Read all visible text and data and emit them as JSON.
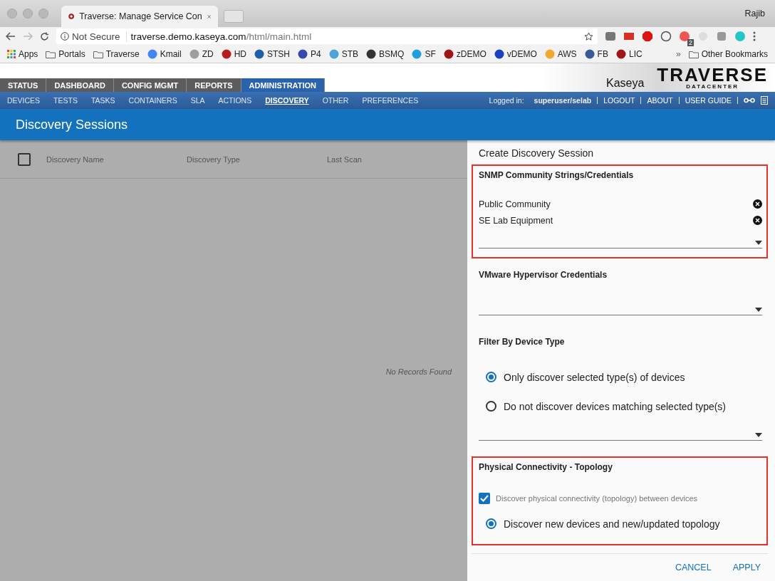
{
  "browser": {
    "tab_title": "Traverse: Manage Service Con",
    "profile": "Rajib",
    "security": "Not Secure",
    "url_host": "traverse.demo.kaseya.com",
    "url_path": "/html/main.html",
    "extension_badge": "2",
    "bookmarks": [
      {
        "kind": "apps",
        "label": "Apps"
      },
      {
        "kind": "folder",
        "label": "Portals"
      },
      {
        "kind": "folder",
        "label": "Traverse"
      },
      {
        "kind": "site",
        "label": "Kmail",
        "color": "#4285f4"
      },
      {
        "kind": "site",
        "label": "ZD",
        "color": "#9e9e9e"
      },
      {
        "kind": "site",
        "label": "HD",
        "color": "#b71c1c"
      },
      {
        "kind": "site",
        "label": "STSH",
        "color": "#1f5fa8"
      },
      {
        "kind": "site",
        "label": "P4",
        "color": "#3949ab"
      },
      {
        "kind": "site",
        "label": "STB",
        "color": "#4fa3d9"
      },
      {
        "kind": "site",
        "label": "BSMQ",
        "color": "#333333"
      },
      {
        "kind": "site",
        "label": "SF",
        "color": "#1ea0e0"
      },
      {
        "kind": "site",
        "label": "zDEMO",
        "color": "#a01515"
      },
      {
        "kind": "site",
        "label": "vDEMO",
        "color": "#1a3fc4"
      },
      {
        "kind": "site",
        "label": "AWS",
        "color": "#f0a830"
      },
      {
        "kind": "site",
        "label": "FB",
        "color": "#3b5998"
      },
      {
        "kind": "site",
        "label": "LIC",
        "color": "#a01515"
      }
    ],
    "overflow": "»",
    "other_bookmarks": "Other Bookmarks"
  },
  "header": {
    "logo_brand": "Kaseya",
    "logo_product": "TRAVERSE",
    "logo_sub": "DATACENTER",
    "main_tabs": [
      {
        "label": "STATUS",
        "selected": false
      },
      {
        "label": "DASHBOARD",
        "selected": false
      },
      {
        "label": "CONFIG MGMT",
        "selected": false
      },
      {
        "label": "REPORTS",
        "selected": false
      },
      {
        "label": "ADMINISTRATION",
        "selected": true
      }
    ],
    "sub_nav": [
      {
        "label": "DEVICES",
        "selected": false
      },
      {
        "label": "TESTS",
        "selected": false
      },
      {
        "label": "TASKS",
        "selected": false
      },
      {
        "label": "CONTAINERS",
        "selected": false
      },
      {
        "label": "SLA",
        "selected": false
      },
      {
        "label": "ACTIONS",
        "selected": false
      },
      {
        "label": "DISCOVERY",
        "selected": true
      },
      {
        "label": "OTHER",
        "selected": false
      },
      {
        "label": "PREFERENCES",
        "selected": false
      }
    ],
    "logged_in_label": "Logged in:",
    "user": "superuser/selab",
    "links": [
      "LOGOUT",
      "ABOUT",
      "USER GUIDE"
    ]
  },
  "page_title": "Discovery Sessions",
  "table": {
    "select_all": {
      "checked": false
    },
    "columns": [
      "Discovery Name",
      "Discovery Type",
      "Last Scan"
    ],
    "empty_message": "No Records Found"
  },
  "panel": {
    "title": "Create Discovery Session",
    "sections": [
      {
        "title": "SNMP Community Strings/Credentials",
        "highlighted": true,
        "items": [
          {
            "kind": "chip",
            "label": "Public Community"
          },
          {
            "kind": "chip",
            "label": "SE Lab Equipment"
          },
          {
            "kind": "select"
          }
        ]
      },
      {
        "title": "VMware Hypervisor Credentials",
        "highlighted": false,
        "items": [
          {
            "kind": "select"
          }
        ]
      },
      {
        "title": "Filter By Device Type",
        "highlighted": false,
        "items": [
          {
            "kind": "radio",
            "label": "Only discover selected type(s) of devices",
            "selected": true
          },
          {
            "kind": "radio",
            "label": "Do not discover devices matching selected type(s)",
            "selected": false
          },
          {
            "kind": "select"
          }
        ]
      },
      {
        "title": "Physical Connectivity - Topology",
        "highlighted": true,
        "items": [
          {
            "kind": "checkbox",
            "label": "Discover physical connectivity (topology) between devices",
            "checked": true
          },
          {
            "kind": "radio",
            "label": "Discover new devices and new/updated topology",
            "selected": true
          }
        ]
      }
    ],
    "buttons": [
      "CANCEL",
      "APPLY"
    ]
  }
}
